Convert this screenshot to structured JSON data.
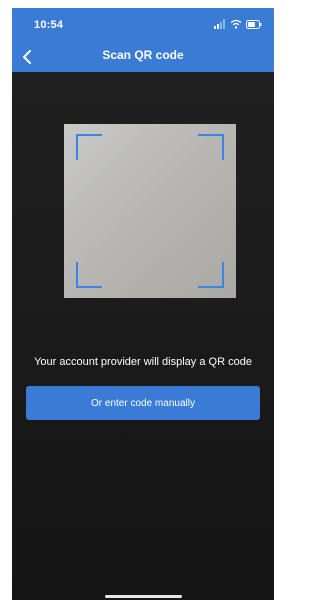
{
  "status_bar": {
    "time": "10:54"
  },
  "header": {
    "title": "Scan QR code",
    "back_icon": "chevron-left-icon"
  },
  "scanner": {
    "instruction": "Your account provider will display a QR code"
  },
  "actions": {
    "manual_entry_label": "Or enter code manually"
  },
  "colors": {
    "accent": "#3a7bd5",
    "camera_background": "#1b1b1b",
    "frame_corners": "#3a86e8"
  }
}
